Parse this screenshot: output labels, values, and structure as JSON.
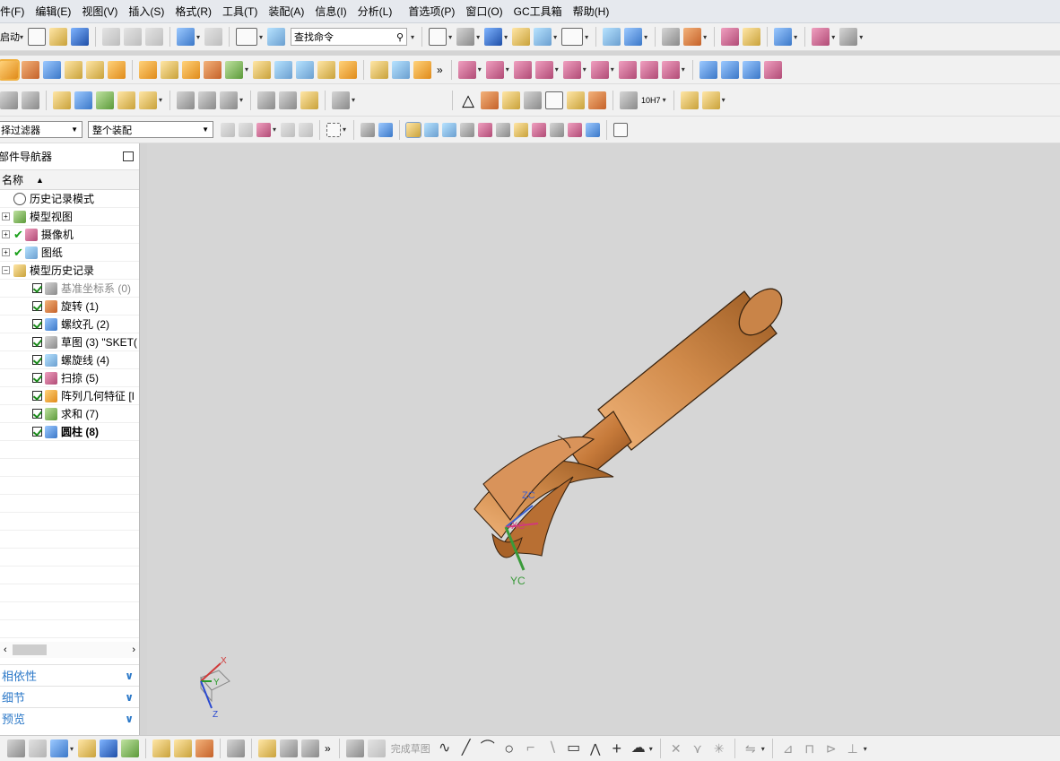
{
  "menubar": {
    "items": [
      "件(F)",
      "编辑(E)",
      "视图(V)",
      "插入(S)",
      "格式(R)",
      "工具(T)",
      "装配(A)",
      "信息(I)",
      "分析(L)",
      "首选项(P)",
      "窗口(O)",
      "GC工具箱",
      "帮助(H)"
    ]
  },
  "toolbar1": {
    "start_label": "启动",
    "search_placeholder": "查找命令"
  },
  "toolbar4": {
    "filter_value": "择过滤器",
    "assembly_value": "整个装配"
  },
  "navigator": {
    "title": "部件导航器",
    "column_name": "名称",
    "nodes": [
      {
        "label": "历史记录模式"
      },
      {
        "label": "模型视图"
      },
      {
        "label": "摄像机"
      },
      {
        "label": "图纸"
      },
      {
        "label": "模型历史记录"
      }
    ],
    "features": [
      {
        "label": "基准坐标系 (0)"
      },
      {
        "label": "旋转 (1)"
      },
      {
        "label": "螺纹孔 (2)"
      },
      {
        "label": "草图 (3) \"SKET("
      },
      {
        "label": "螺旋线 (4)"
      },
      {
        "label": "扫掠 (5)"
      },
      {
        "label": "阵列几何特征 [I"
      },
      {
        "label": "求和 (7)"
      },
      {
        "label": "圆柱 (8)"
      }
    ]
  },
  "panels": {
    "dependency": "相依性",
    "details": "细节",
    "preview": "预览"
  },
  "viewport": {
    "axis_zc": "ZC",
    "axis_xc": "XC",
    "axis_yc": "YC",
    "triad_x": "X",
    "triad_y": "Y",
    "triad_z": "Z"
  },
  "bottombar": {
    "finish_sketch": "完成草图"
  },
  "toolbar3": {
    "tolerance_label": "10H7"
  }
}
